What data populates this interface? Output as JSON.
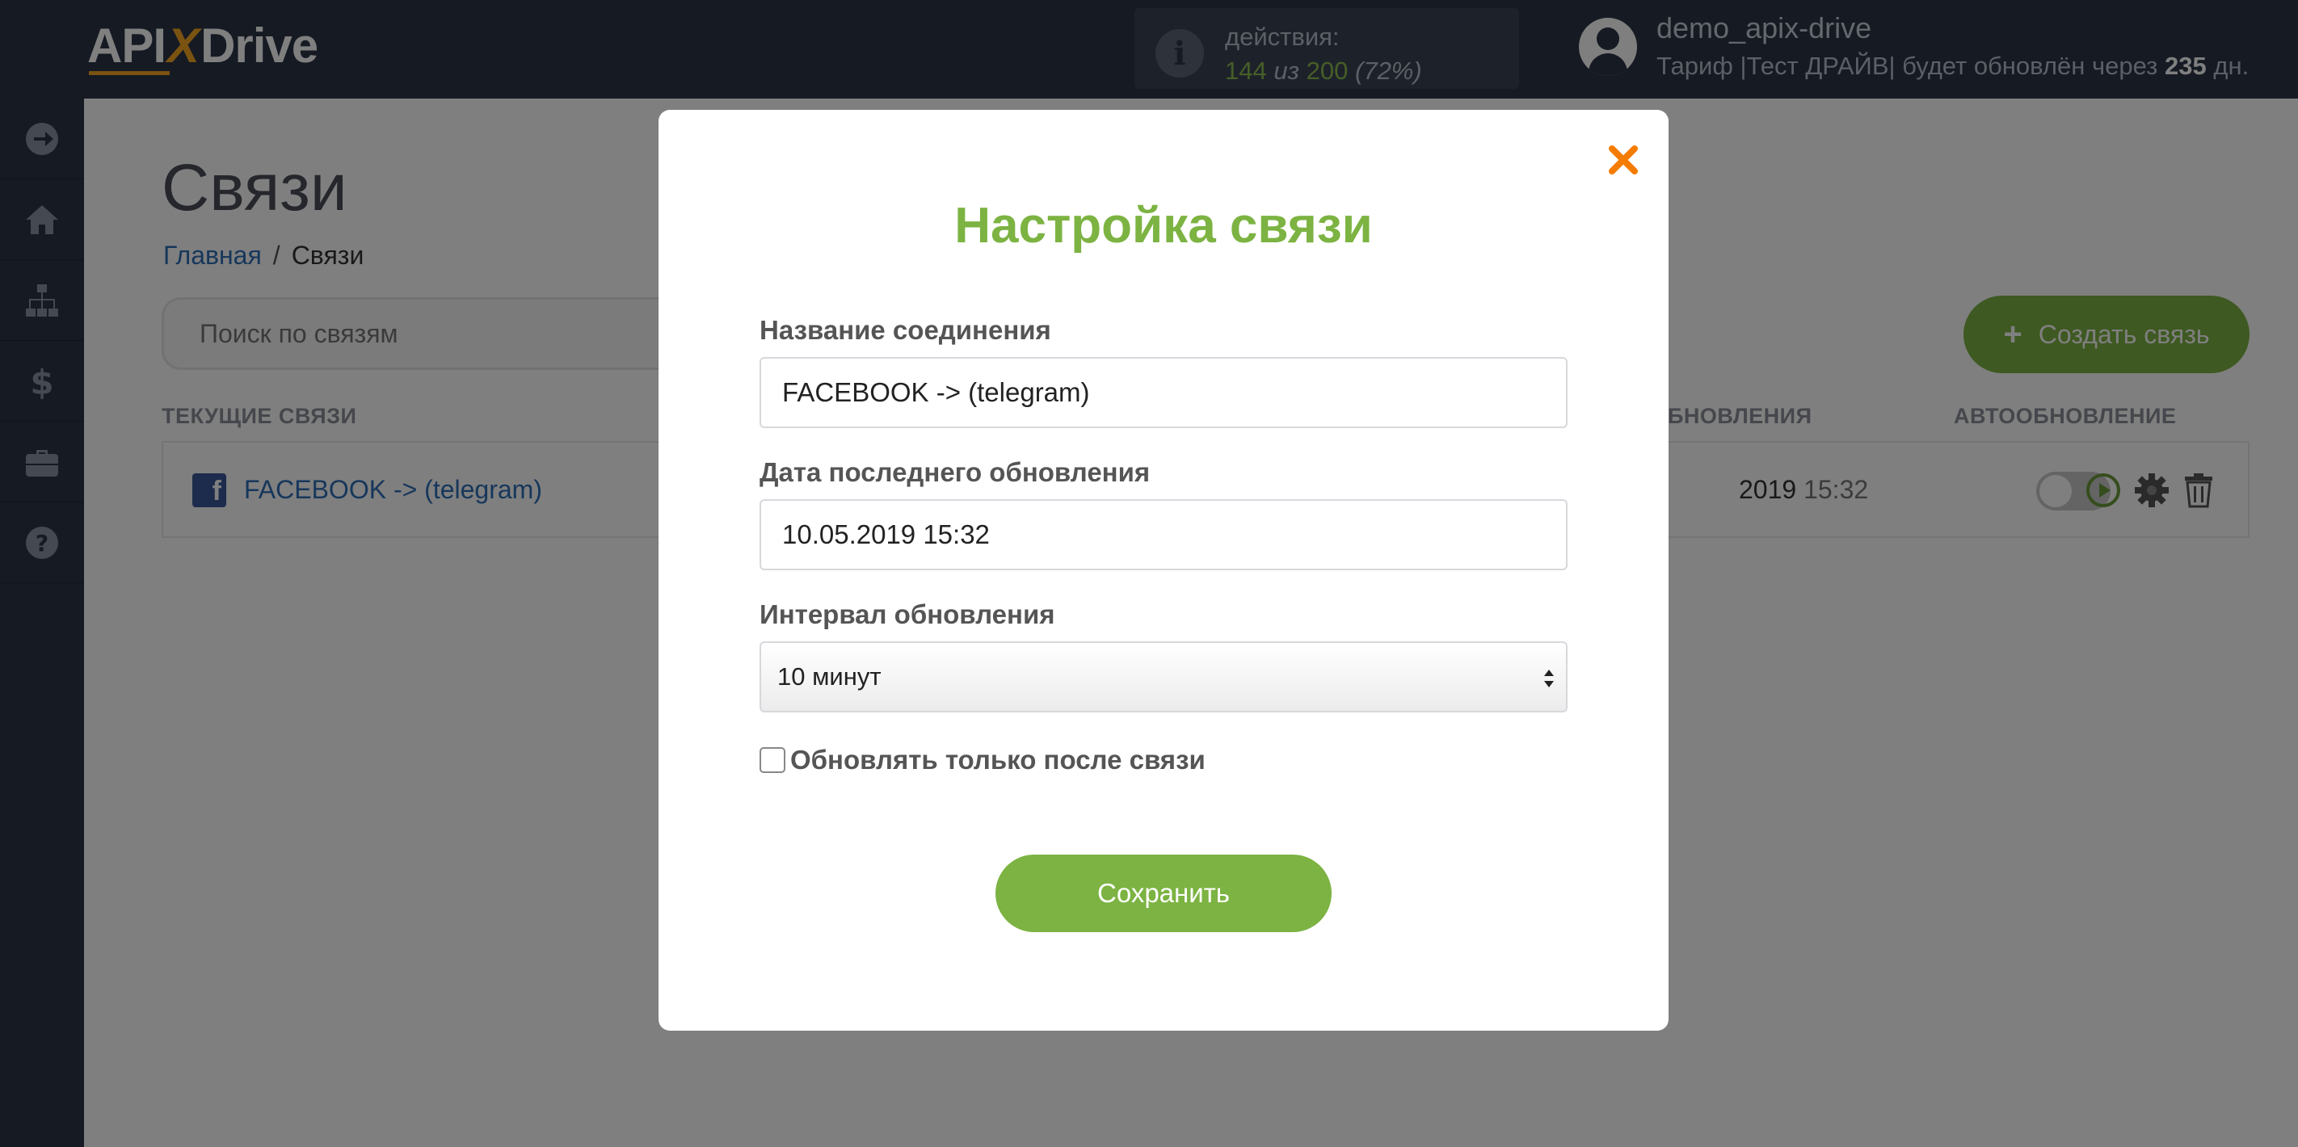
{
  "app": {
    "logo_left": "API",
    "logo_x": "X",
    "logo_right": "Drive"
  },
  "header": {
    "actions_label": "действия:",
    "actions_used": "144",
    "actions_of": "из",
    "actions_total": "200",
    "actions_percent": "(72%)",
    "user_name": "demo_apix-drive",
    "tariff_prefix": "Тариф |Тест ДРАЙВ| будет обновлён через",
    "tariff_days": "235",
    "tariff_suffix": "дн."
  },
  "sidebar": {
    "items": [
      "arrow-right-icon",
      "home-icon",
      "sitemap-icon",
      "dollar-icon",
      "briefcase-icon",
      "question-icon"
    ]
  },
  "page": {
    "title": "Связи",
    "breadcrumb_home": "Главная",
    "breadcrumb_sep": "/",
    "breadcrumb_current": "Связи",
    "search_placeholder": "Поиск по связям",
    "create_label": "Создать связь",
    "col_current": "ТЕКУЩИЕ СВЯЗИ",
    "col_updates": "БНОВЛЕНИЯ",
    "col_autoupdate": "АВТООБНОВЛЕНИЕ",
    "row": {
      "name": "FACEBOOK -> (telegram)",
      "date_part": "2019",
      "time_part": "15:32",
      "autoupdate_on": false
    }
  },
  "modal": {
    "title": "Настройка связи",
    "name_label": "Название соединения",
    "name_value": "FACEBOOK -> (telegram)",
    "date_label": "Дата последнего обновления",
    "date_value": "10.05.2019 15:32",
    "interval_label": "Интервал обновления",
    "interval_value": "10 минут",
    "checkbox_label": "Обновлять только после связи",
    "checkbox_checked": false,
    "save_label": "Сохранить"
  },
  "colors": {
    "topbar": "#2a3446",
    "accent_green": "#7cb342",
    "accent_orange": "#f5a623",
    "link_blue": "#2e6fb7",
    "close_orange": "#f57c00"
  }
}
